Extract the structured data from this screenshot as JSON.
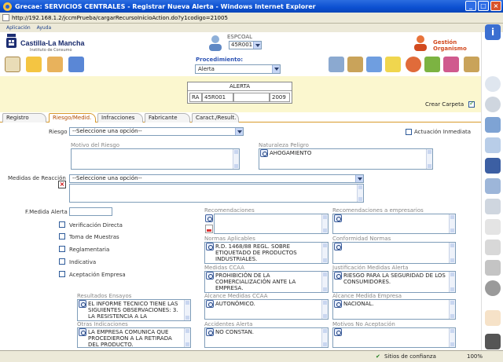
{
  "window": {
    "title": "Grecae: SERVICIOS CENTRALES - Registrar Nueva Alerta - Windows Internet Explorer",
    "url": "http://192.168.1.2/jccmPrueba/cargarRecursoInicioAction.do?y1codigo=21005"
  },
  "menu": [
    "Aplicación",
    "Ayuda"
  ],
  "header": {
    "logo_name": "Castilla-La Mancha",
    "logo_sub": "Instituto de Consumo",
    "user_label": "ESPCOAL",
    "user_value": "45R001",
    "gestion_label": "Gestión Organismo",
    "procedimiento_label": "Procedimiento:",
    "procedimiento_value": "Alerta"
  },
  "alerta": {
    "title": "ALERTA",
    "cells": [
      "RA",
      "45R001",
      "",
      "2009"
    ],
    "crear_carpeta": "Crear Carpeta"
  },
  "tabs": [
    "Registro",
    "Riesgo/Medid.",
    "Infracciones",
    "Fabricante",
    "Caract./Result."
  ],
  "form": {
    "riesgo_label": "Riesgo",
    "riesgo_value": "--Seleccione una opción--",
    "actuacion_label": "Actuación Inmediata",
    "motivo_label": "Motivo del Riesgo",
    "naturaleza_label": "Naturaleza Peligro",
    "naturaleza_value": "AHOGAMIENTO",
    "medidas_label": "Medidas de Reacción",
    "medidas_value": "--Seleccione una opción--",
    "fmedida_label": "F.Medida Alerta",
    "recomendaciones_label": "Recomendaciones",
    "recom_empresarios_label": "Recomendaciones a empresarios",
    "normas_label": "Normas Aplicables",
    "normas_value": "R.D. 1468/88 REGL. SOBRE ETIQUETADO DE PRODUCTOS INDUSTRIALES.",
    "conformidad_label": "Conformidad Normas",
    "medidas_ccaa_label": "Medidas CCAA",
    "medidas_ccaa_value": "PROHIBICIÓN DE LA COMERCIALIZACIÓN ANTE LA EMPRESA.",
    "justificacion_label": "Justificación Medidas Alerta",
    "justificacion_value": "RIESGO PARA LA SEGURIDAD DE LOS CONSUMIDORES.",
    "checkboxes": [
      "Verificación Directa",
      "Toma de Muestras",
      "Reglamentaria",
      "Indicativa",
      "Aceptación Empresa"
    ],
    "resultados_label": "Resultados Ensayos",
    "resultados_value": "EL INFORME TECNICO TIENE LAS SIGUIENTES OBSERVACIONES: 3. LA RESISTENCIA A LA",
    "alcance_ccaa_label": "Alcance Medidas CCAA",
    "alcance_ccaa_value": "AUTONÓMICO.",
    "alcance_empresa_label": "Alcance Medida Empresa",
    "alcance_empresa_value": "NACIONAL.",
    "otras_label": "Otras Indicaciones",
    "otras_value": "LA EMPRESA COMUNICA QUE PROCEDIERON A LA RETIRADA DEL PRODUCTO.",
    "accidentes_label": "Accidentes Alerta",
    "accidentes_value": "NO CONSTAN.",
    "motivos_label": "Motivos No Aceptación"
  },
  "status": {
    "zone": "Sitios de confianza",
    "zoom": "100%"
  },
  "colors": {
    "titlebar": "#0b4fd1",
    "yellow_band": "#fbf7cf",
    "active_tab": "#b04b00"
  }
}
